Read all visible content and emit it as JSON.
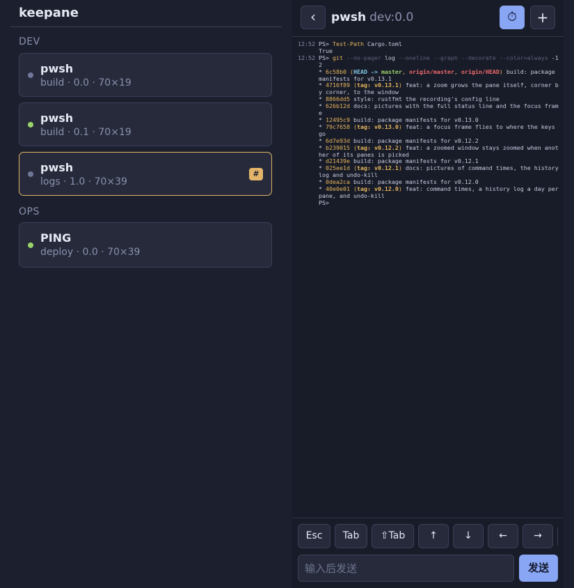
{
  "app": {
    "title": "keepane"
  },
  "groups": [
    {
      "label": "DEV",
      "sessions": [
        {
          "name": "pwsh",
          "meta": "build · 0.0 · 70×19",
          "status_color": "#6f7898",
          "active": false
        },
        {
          "name": "pwsh",
          "meta": "build · 0.1 · 70×19",
          "status_color": "#9ad36a",
          "active": false
        },
        {
          "name": "pwsh",
          "meta": "logs · 1.0 · 70×39",
          "status_color": "#6f7898",
          "active": true,
          "badge": "#"
        }
      ]
    },
    {
      "label": "OPS",
      "sessions": [
        {
          "name": "PING",
          "meta": "deploy · 0.0 · 70×39",
          "status_color": "#9ad36a",
          "active": false
        }
      ]
    }
  ],
  "header": {
    "back_icon": "chevron-left-icon",
    "back_glyph": "‹",
    "title": "pwsh",
    "subtitle": "dev:0.0",
    "timer_icon": "stopwatch-icon",
    "timer_glyph": "⏱",
    "add_icon": "plus-icon",
    "add_glyph": "+"
  },
  "terminal": {
    "lines": [
      {
        "ts": "12:52",
        "segs": [
          {
            "t": "PS> ",
            "c": ""
          },
          {
            "t": "Test-Path",
            "c": "c-cmd"
          },
          {
            "t": " Cargo.toml",
            "c": ""
          }
        ]
      },
      {
        "ts": "",
        "segs": [
          {
            "t": "True",
            "c": ""
          }
        ]
      },
      {
        "ts": "12:52",
        "segs": [
          {
            "t": "PS> ",
            "c": ""
          },
          {
            "t": "git",
            "c": "c-cmd"
          },
          {
            "t": " --no-pager",
            "c": "c-dim"
          },
          {
            "t": " log ",
            "c": ""
          },
          {
            "t": "--oneline --graph --decorate --color=always",
            "c": "c-dim"
          },
          {
            "t": " -12",
            "c": ""
          }
        ]
      },
      {
        "ts": "",
        "segs": [
          {
            "t": "* ",
            "c": ""
          },
          {
            "t": "6c58b0",
            "c": "c-hash"
          },
          {
            "t": " (",
            "c": "c-paren"
          },
          {
            "t": "HEAD -> ",
            "c": "c-head"
          },
          {
            "t": "master",
            "c": "c-master"
          },
          {
            "t": ", ",
            "c": "c-paren"
          },
          {
            "t": "origin/master",
            "c": "c-origin"
          },
          {
            "t": ", ",
            "c": "c-paren"
          },
          {
            "t": "origin/HEAD",
            "c": "c-origin"
          },
          {
            "t": ")",
            "c": "c-paren"
          },
          {
            "t": " build: package manifests for v0.13.1",
            "c": ""
          }
        ]
      },
      {
        "ts": "",
        "segs": [
          {
            "t": "* ",
            "c": ""
          },
          {
            "t": "4716f89",
            "c": "c-hash"
          },
          {
            "t": " (",
            "c": "c-paren"
          },
          {
            "t": "tag: v0.13.1",
            "c": "c-tag"
          },
          {
            "t": ")",
            "c": "c-paren"
          },
          {
            "t": " feat: a zoom grows the pane itself, corner by corner, to the window",
            "c": ""
          }
        ]
      },
      {
        "ts": "",
        "segs": [
          {
            "t": "* ",
            "c": ""
          },
          {
            "t": "8866dd5",
            "c": "c-hash"
          },
          {
            "t": " style: rustfmt the recording's config line",
            "c": ""
          }
        ]
      },
      {
        "ts": "",
        "segs": [
          {
            "t": "* ",
            "c": ""
          },
          {
            "t": "626b12d",
            "c": "c-hash"
          },
          {
            "t": " docs: pictures with the full status line and the focus frame",
            "c": ""
          }
        ]
      },
      {
        "ts": "",
        "segs": [
          {
            "t": "* ",
            "c": ""
          },
          {
            "t": "12495c9",
            "c": "c-hash"
          },
          {
            "t": " build: package manifests for v0.13.0",
            "c": ""
          }
        ]
      },
      {
        "ts": "",
        "segs": [
          {
            "t": "* ",
            "c": ""
          },
          {
            "t": "79c7658",
            "c": "c-hash"
          },
          {
            "t": " (",
            "c": "c-paren"
          },
          {
            "t": "tag: v0.13.0",
            "c": "c-tag"
          },
          {
            "t": ")",
            "c": "c-paren"
          },
          {
            "t": " feat: a focus frame flies to where the keys go",
            "c": ""
          }
        ]
      },
      {
        "ts": "",
        "segs": [
          {
            "t": "* ",
            "c": ""
          },
          {
            "t": "6d7e93d",
            "c": "c-hash"
          },
          {
            "t": " build: package manifests for v0.12.2",
            "c": ""
          }
        ]
      },
      {
        "ts": "",
        "segs": [
          {
            "t": "* ",
            "c": ""
          },
          {
            "t": "b239015",
            "c": "c-hash"
          },
          {
            "t": " (",
            "c": "c-paren"
          },
          {
            "t": "tag: v0.12.2",
            "c": "c-tag"
          },
          {
            "t": ")",
            "c": "c-paren"
          },
          {
            "t": " feat: a zoomed window stays zoomed when another of its panes is picked",
            "c": ""
          }
        ]
      },
      {
        "ts": "",
        "segs": [
          {
            "t": "* ",
            "c": ""
          },
          {
            "t": "d21439e",
            "c": "c-hash"
          },
          {
            "t": " build: package manifests for v0.12.1",
            "c": ""
          }
        ]
      },
      {
        "ts": "",
        "segs": [
          {
            "t": "* ",
            "c": ""
          },
          {
            "t": "025ee1d",
            "c": "c-hash"
          },
          {
            "t": " (",
            "c": "c-paren"
          },
          {
            "t": "tag: v0.12.1",
            "c": "c-tag"
          },
          {
            "t": ")",
            "c": "c-paren"
          },
          {
            "t": " docs: pictures of command times, the history log and undo-kill",
            "c": ""
          }
        ]
      },
      {
        "ts": "",
        "segs": [
          {
            "t": "* ",
            "c": ""
          },
          {
            "t": "0dea2ca",
            "c": "c-hash"
          },
          {
            "t": " build: package manifests for v0.12.0",
            "c": ""
          }
        ]
      },
      {
        "ts": "",
        "segs": [
          {
            "t": "* ",
            "c": ""
          },
          {
            "t": "40e0e01",
            "c": "c-hash"
          },
          {
            "t": " (",
            "c": "c-paren"
          },
          {
            "t": "tag: v0.12.0",
            "c": "c-tag"
          },
          {
            "t": ")",
            "c": "c-paren"
          },
          {
            "t": " feat: command times, a history log a day per pane, and undo-kill",
            "c": ""
          }
        ]
      },
      {
        "ts": "",
        "segs": [
          {
            "t": "PS>",
            "c": ""
          }
        ]
      }
    ]
  },
  "keys": [
    "Esc",
    "Tab",
    "⇧Tab",
    "↑",
    "↓",
    "←",
    "→"
  ],
  "input": {
    "placeholder": "输入后发送",
    "value": ""
  },
  "send_label": "发送",
  "colors": {
    "accent": "#89a6f5",
    "active_border": "#e3b56a",
    "online": "#9ad36a",
    "idle": "#6f7898"
  }
}
